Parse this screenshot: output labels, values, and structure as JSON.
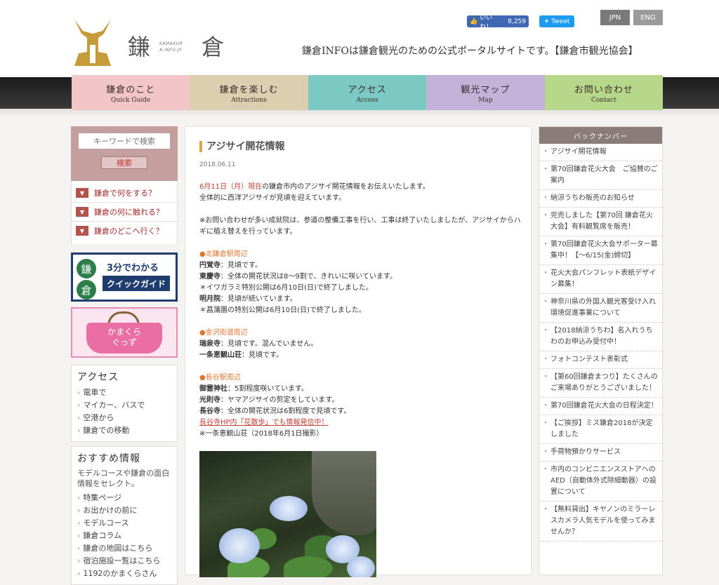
{
  "header": {
    "logo_kanji_1": "鎌",
    "logo_kanji_2": "倉",
    "logo_sub": "KAMAKURA-INFO.JP",
    "fb_like_label": "いいね！",
    "fb_like_count": "8,259",
    "tweet_label": "Tweet",
    "lang_jpn": "JPN",
    "lang_eng": "ENG",
    "tagline": "鎌倉INFOは鎌倉観光のための公式ポータルサイトです。【鎌倉市観光協会】"
  },
  "nav": [
    {
      "jp": "鎌倉のこと",
      "en": "Quick Guide",
      "color": "#f2c6c9"
    },
    {
      "jp": "鎌倉を楽しむ",
      "en": "Attractions",
      "color": "#dccfb0"
    },
    {
      "jp": "アクセス",
      "en": "Access",
      "color": "#7cc9c4"
    },
    {
      "jp": "観光マップ",
      "en": "Map",
      "color": "#c2b2d8"
    },
    {
      "jp": "お問い合わせ",
      "en": "Contact",
      "color": "#b7d88a"
    }
  ],
  "left": {
    "search_placeholder": "キーワードで検索",
    "search_button": "検索",
    "quick_links": [
      "鎌倉で何をする？",
      "鎌倉の何に触れる？",
      "鎌倉のどこへ行く？"
    ],
    "banner1_kama": "鎌",
    "banner1_kura": "倉",
    "banner1_line1": "3分でわかる",
    "banner1_line2": "クイックガイド",
    "banner2_text": "かまくら\nぐっず",
    "access_title": "アクセス",
    "access_links": [
      "電車で",
      "マイカー、バスで",
      "空港から",
      "鎌倉での移動"
    ],
    "recommend_title": "おすすめ情報",
    "recommend_desc": "モデルコースや鎌倉の面白情報をセレクト。",
    "recommend_links": [
      "特集ページ",
      "お出かけの前に",
      "モデルコース",
      "鎌倉コラム",
      "鎌倉の地図はこちら",
      "宿泊施設一覧はこちら",
      "1192のかまくらさん"
    ]
  },
  "article": {
    "title": "アジサイ開花情報",
    "date": "2018.06.11",
    "intro_red": "6月11日（月）現在",
    "intro_rest": "の鎌倉市内のアジサイ開花情報をお伝えいたします。",
    "intro_line2": "全体的に西洋アジサイが見頃を迎えています。",
    "note": "※お問い合わせが多い成就院は、参道の整備工事を行い、工事は終了いたしましたが、アジサイからハギに植え替えを行っています。",
    "sec1_title": "●北鎌倉駅周辺",
    "sec1_lines": [
      {
        "name": "円覚寺",
        "text": "：見頃です。"
      },
      {
        "name": "東慶寺",
        "text": "：全体の開花状況は8～9割で、きれいに咲いています。"
      },
      {
        "name": "",
        "text": "＊イワガラミ特別公開は6月10日(日)で終了しました。"
      },
      {
        "name": "明月院",
        "text": "：見頃が続いています。"
      },
      {
        "name": "",
        "text": "＊菖蒲園の特別公開は6月10日(日)で終了しました。"
      }
    ],
    "sec2_title": "●金沢街道周辺",
    "sec2_lines": [
      {
        "name": "瑞泉寺",
        "text": "：見頃です。混んでいません。"
      },
      {
        "name": "一条恵観山荘",
        "text": "：見頃です。"
      }
    ],
    "sec3_title": "●長谷駅周辺",
    "sec3_lines": [
      {
        "name": "御霊神社",
        "text": "：5割程度咲いています。"
      },
      {
        "name": "光則寺",
        "text": "：ヤマアジサイの剪定をしています。"
      },
      {
        "name": "長谷寺",
        "text": "：全体の開花状況は6割程度で見頃です。"
      }
    ],
    "sec3_link": "長谷寺HP内「花散歩」でも情報発信中！",
    "photo_caption": "※一条恵観山荘（2018年6月1日撮影）"
  },
  "backnumber": {
    "title": "バックナンバー",
    "items": [
      "アジサイ開花情報",
      "第70回鎌倉花火大会　ご協賛のご案内",
      "納涼うちわ販売のお知らせ",
      "完売しました【第70回 鎌倉花火大会】有料観覧席を販売！",
      "第70回鎌倉花火大会サポーター募集中！【～6/15(金)締切】",
      "花火大会パンフレット表紙デザイン募集！",
      "神奈川県の外国人観光客受け入れ環境促進事業について",
      "【2018納涼うちわ】名入れうちわのお申込み受付中！",
      "フォトコンテスト表彰式",
      "【第60回鎌倉まつり】たくさんのご来場ありがとうございました！",
      "第70回鎌倉花火大会の日程決定！",
      "【ご挨拶】ミス鎌倉2018が決定しました",
      "手荷物預かりサービス",
      "市内のコンビニエンスストアへのAED（自動体外式除細動器）の設置について",
      "【無料貸出】キヤノンのミラーレスカメラ人気モデルを使ってみませんか？"
    ]
  }
}
